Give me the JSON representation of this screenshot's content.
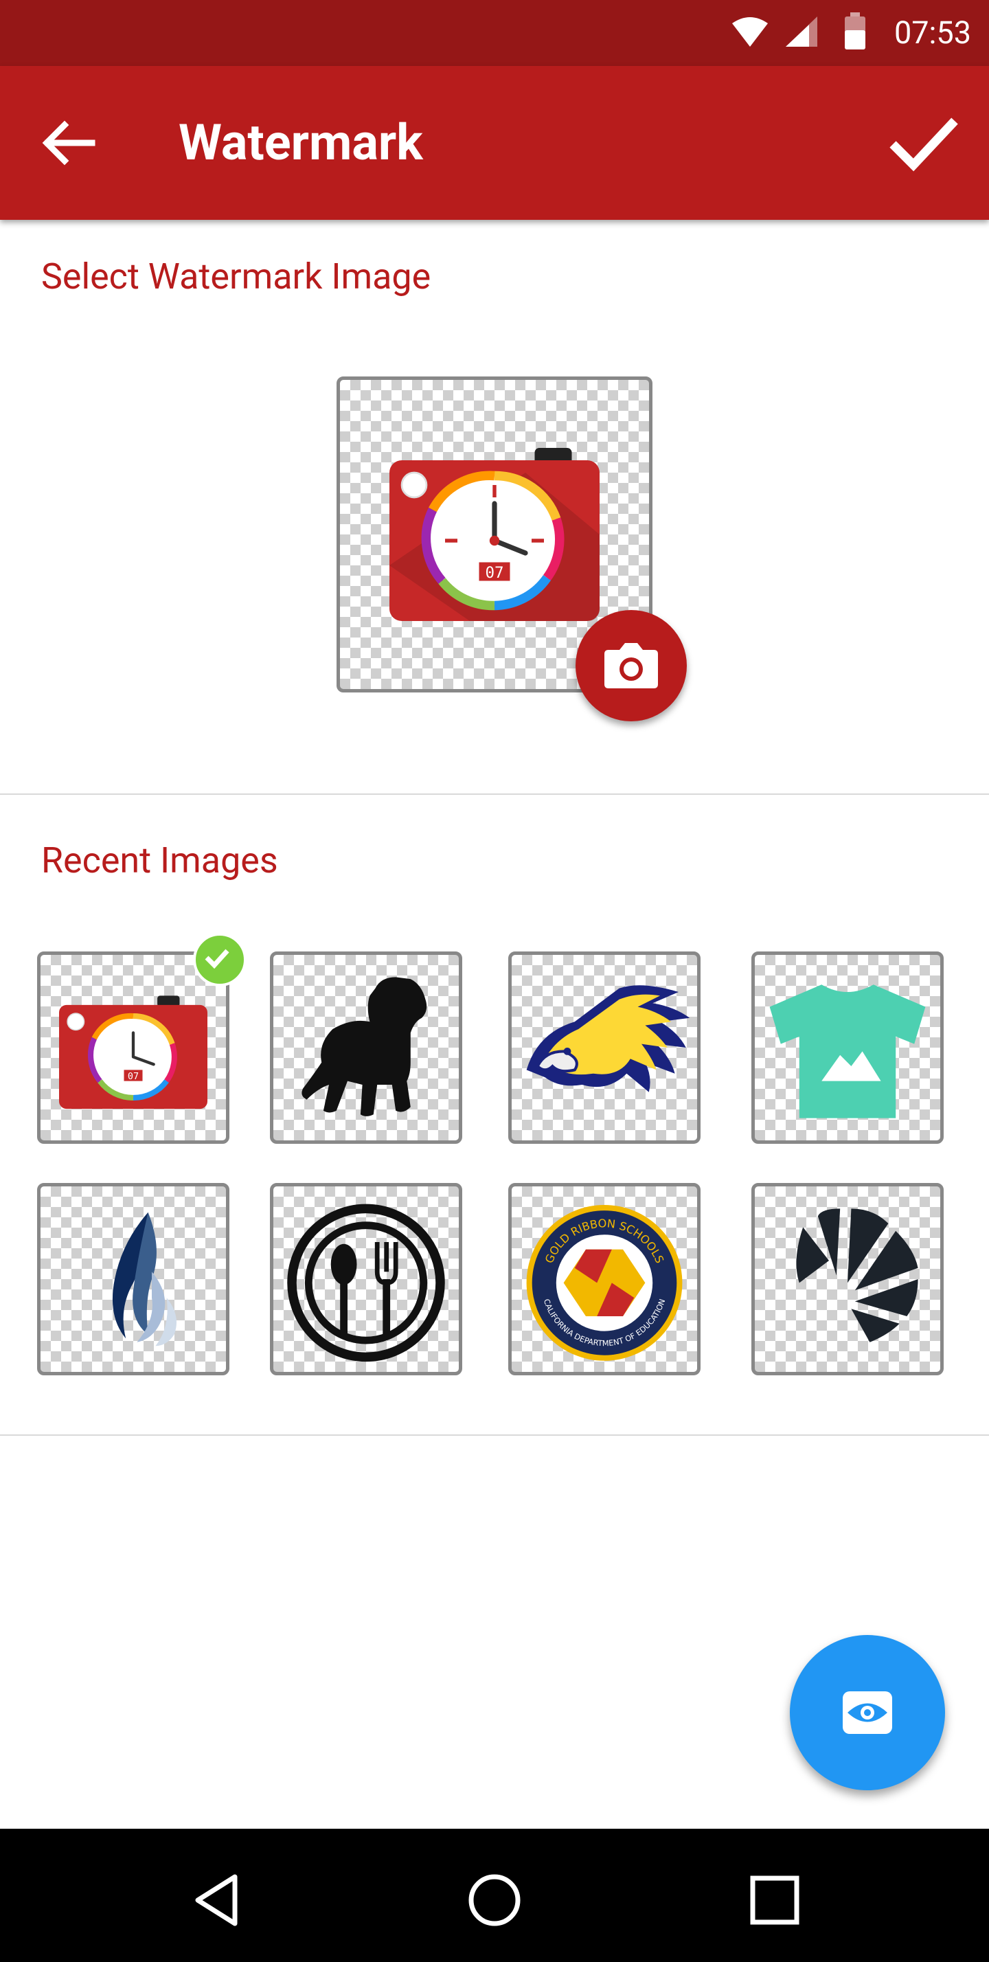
{
  "status_bar": {
    "time": "07:53"
  },
  "app_bar": {
    "title": "Watermark"
  },
  "sections": {
    "select_title": "Select Watermark Image",
    "recent_title": "Recent Images"
  },
  "tile_digits": "07",
  "seal_text": {
    "top": "GOLD RIBBON SCHOOLS",
    "bottom": "CALIFORNIA DEPARTMENT OF EDUCATION"
  },
  "recent_images": [
    {
      "name": "camera-clock-logo",
      "selected": true
    },
    {
      "name": "dog-silhouette",
      "selected": false
    },
    {
      "name": "eagle-logo",
      "selected": false
    },
    {
      "name": "tshirt-icon",
      "selected": false
    },
    {
      "name": "flame-logo",
      "selected": false
    },
    {
      "name": "fork-spoon-icon",
      "selected": false
    },
    {
      "name": "gold-ribbon-seal",
      "selected": false
    },
    {
      "name": "shell-logo",
      "selected": false
    }
  ],
  "colors": {
    "primary": "#b71c1c",
    "status": "#951717",
    "accent": "#2196f3",
    "check": "#7ccf3c"
  }
}
